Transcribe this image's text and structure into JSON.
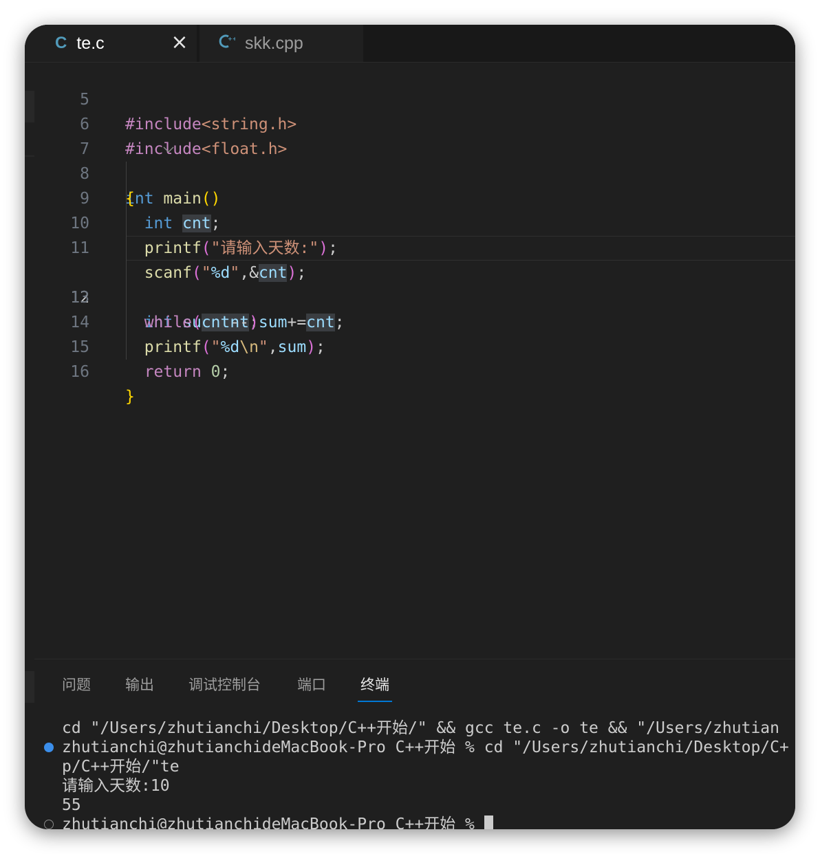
{
  "tabs": {
    "active": {
      "icon": "C",
      "name": "te.c",
      "close": "×"
    },
    "inactive": {
      "icon": "G",
      "name": "skk.cpp"
    }
  },
  "editor": {
    "line_numbers": [
      "5",
      "6",
      "7",
      "8",
      "9",
      "10",
      "11",
      "12",
      "13",
      "14",
      "15",
      "16"
    ],
    "fold_marker": "﹀",
    "tokens": {
      "inc1_kw": "#include",
      "inc1_file": "<string.h>",
      "inc2_kw": "#include",
      "inc2_file": "<float.h>",
      "int": "int",
      "main": "main",
      "lparen": "(",
      "rparen": ")",
      "lbrace": "{",
      "rbrace": "}",
      "cnt": "cnt",
      "semi": ";",
      "printf": "printf",
      "prompt_str": "\"请输入天数:\"",
      "scanf": "scanf",
      "fmt_q1": "\"",
      "fmt_d": "%d",
      "fmt_q2": "\"",
      "comma_amp": ",&",
      "sum": "sum",
      "eq": "=",
      "while": "while",
      "minusminus": "--",
      "pluseq": "+=",
      "esc_n": "\\n",
      "comma": ",",
      "return": "return",
      "zero": "0"
    }
  },
  "panel": {
    "tabs": [
      "问题",
      "输出",
      "调试控制台",
      "端口",
      "终端"
    ],
    "active_tab": "终端",
    "terminal": [
      "cd \"/Users/zhutianchi/Desktop/C++开始/\" && gcc te.c -o te && \"/Users/zhutian",
      "zhutianchi@zhutianchideMacBook-Pro C++开始 % cd \"/Users/zhutianchi/Desktop/C+",
      "p/C++开始/\"te",
      "请输入天数:10",
      "55",
      "zhutianchi@zhutianchideMacBook-Pro C++开始 % "
    ]
  }
}
